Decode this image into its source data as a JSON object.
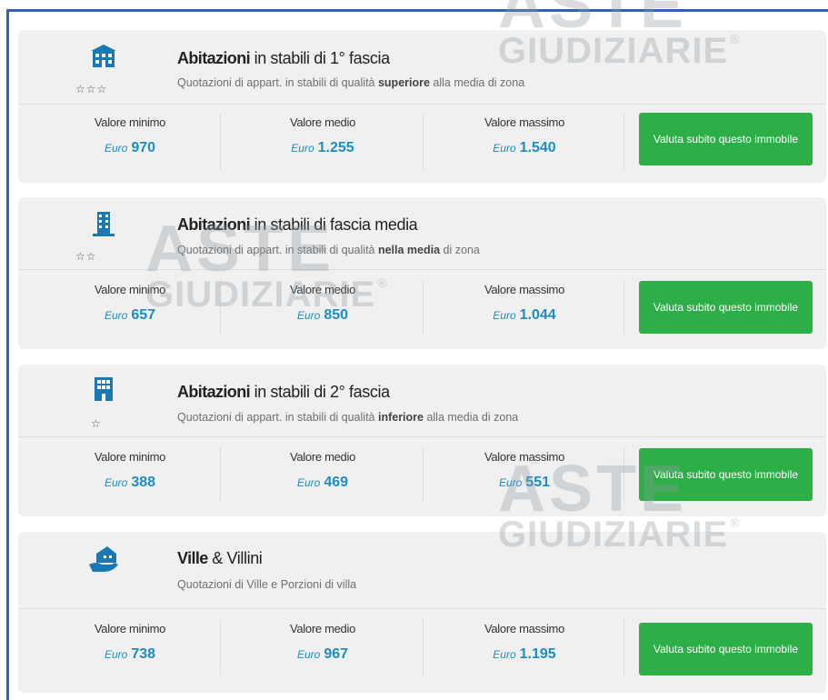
{
  "watermark": {
    "line1": "ASTE",
    "line2": "GIUDIZIARIE",
    "mark": "®"
  },
  "labels": {
    "min": "Valore minimo",
    "mid": "Valore medio",
    "max": "Valore massimo",
    "currency": "Euro"
  },
  "cta_label": "Valuta subito questo immobile",
  "accent": {
    "value": "#1d8ec0",
    "button": "#2daf48",
    "icon": "#1a78b5",
    "frame": "#2f63ad"
  },
  "cards": [
    {
      "icon": "house-icon",
      "stars": "☆☆☆",
      "title_bold": "Abitazioni",
      "title_rest": " in stabili di 1° fascia",
      "sub_pre": "Quotazioni di appart. in stabili di qualità ",
      "sub_bold": "superiore",
      "sub_post": " alla media di zona",
      "min": "970",
      "mid": "1.255",
      "max": "1.540"
    },
    {
      "icon": "building-icon",
      "stars": "☆☆",
      "title_bold": "Abitazioni",
      "title_rest": " in stabili di fascia media",
      "sub_pre": "Quotazioni di appart. in stabili di qualità ",
      "sub_bold": "nella media",
      "sub_post": " di zona",
      "min": "657",
      "mid": "850",
      "max": "1.044"
    },
    {
      "icon": "apartment-block-icon",
      "stars": "☆",
      "title_bold": "Abitazioni",
      "title_rest": " in stabili di 2° fascia",
      "sub_pre": "Quotazioni di appart. in stabili di qualità ",
      "sub_bold": "inferiore",
      "sub_post": " alla media di zona",
      "min": "388",
      "mid": "469",
      "max": "551"
    },
    {
      "icon": "villa-hand-icon",
      "stars": "",
      "title_bold": "Ville",
      "title_rest": " & Villini",
      "sub_pre": "Quotazioni di Ville e Porzioni di villa",
      "sub_bold": "",
      "sub_post": "",
      "min": "738",
      "mid": "967",
      "max": "1.195"
    }
  ]
}
